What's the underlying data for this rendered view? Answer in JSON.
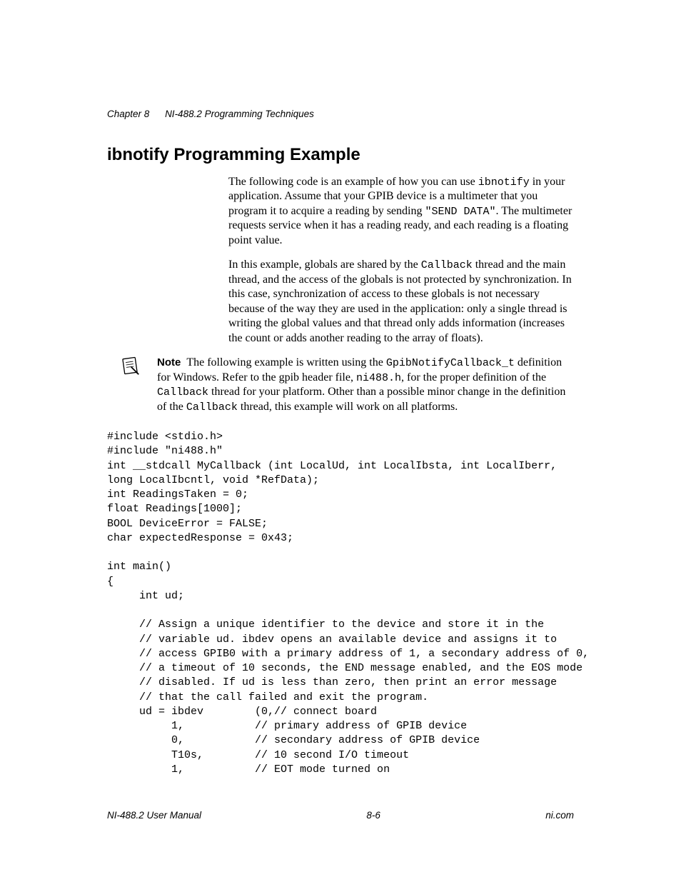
{
  "header": {
    "chapter": "Chapter 8",
    "title": "NI-488.2 Programming Techniques"
  },
  "section_title": "ibnotify Programming Example",
  "para1": {
    "t1": "The following code is an example of how you can use ",
    "code1": "ibnotify",
    "t2": " in your application. Assume that your GPIB device is a multimeter that you program it to acquire a reading by sending ",
    "code2": "\"SEND DATA\"",
    "t3": ". The multimeter requests service when it has a reading ready, and each reading is a floating point value."
  },
  "para2": {
    "t1": "In this example, globals are shared by the ",
    "code1": "Callback",
    "t2": " thread and the main thread, and the access of the globals is not protected by synchronization. In this case, synchronization of access to these globals is not necessary because of the way they are used in the application: only a single thread is writing the global values and that thread only adds information (increases the count or adds another reading to the array of floats)."
  },
  "note": {
    "label": "Note",
    "t1": "The following example is written using the ",
    "code1": "GpibNotifyCallback_t",
    "t2": " definition for Windows. Refer to the gpib header file, ",
    "code2": "ni488.h",
    "t3": ", for the proper definition of the ",
    "code3": "Callback",
    "t4": " thread for your platform. Other than a possible minor change in the definition of the ",
    "code4": "Callback",
    "t5": " thread, this example will work on all platforms."
  },
  "code": "#include <stdio.h>\n#include \"ni488.h\"\nint __stdcall MyCallback (int LocalUd, int LocalIbsta, int LocalIberr,\nlong LocalIbcntl, void *RefData);\nint ReadingsTaken = 0;\nfloat Readings[1000];\nBOOL DeviceError = FALSE;\nchar expectedResponse = 0x43;\n\nint main()\n{\n     int ud;\n\n     // Assign a unique identifier to the device and store it in the\n     // variable ud. ibdev opens an available device and assigns it to\n     // access GPIB0 with a primary address of 1, a secondary address of 0,\n     // a timeout of 10 seconds, the END message enabled, and the EOS mode\n     // disabled. If ud is less than zero, then print an error message\n     // that the call failed and exit the program.\n     ud = ibdev        (0,// connect board\n          1,           // primary address of GPIB device\n          0,           // secondary address of GPIB device\n          T10s,        // 10 second I/O timeout\n          1,           // EOT mode turned on",
  "footer": {
    "left": "NI-488.2 User Manual",
    "center": "8-6",
    "right": "ni.com"
  }
}
